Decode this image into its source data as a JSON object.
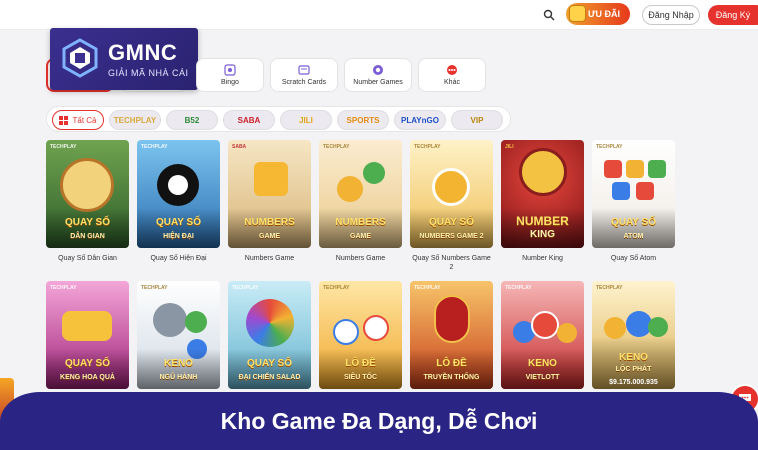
{
  "header": {
    "promo_label": "ƯU ĐÃI",
    "login_label": "Đăng Nhập",
    "register_label": "Đăng Ký"
  },
  "logo": {
    "title": "GMNC",
    "subtitle": "GIẢI MÃ NHÀ CÁI"
  },
  "categories": [
    {
      "label": "Bingo",
      "icon": "bingo-icon"
    },
    {
      "label": "Scratch Cards",
      "icon": "scratch-card-icon"
    },
    {
      "label": "Number Games",
      "icon": "number-ball-icon"
    },
    {
      "label": "Khác",
      "icon": "more-icon"
    }
  ],
  "providers": {
    "all_label": "Tất Cả",
    "items": [
      "TECHPLAY",
      "B52",
      "SABA",
      "JILI",
      "SPORTS",
      "PLAYnGO",
      "VIP"
    ]
  },
  "games_row1": [
    {
      "name": "Quay Số Dân Gian",
      "line1": "QUAY SỐ",
      "line2": "DÂN GIAN",
      "provider": "TECHPLAY",
      "bg": "#3f7a3a"
    },
    {
      "name": "Quay Số Hiện Đại",
      "line1": "QUAY SỐ",
      "line2": "HIỆN ĐẠI",
      "provider": "TECHPLAY",
      "bg": "#2d7fc2"
    },
    {
      "name": "Numbers Game",
      "line1": "NUMBERS",
      "line2": "GAME",
      "provider": "SABA",
      "bg": "#e7c98a"
    },
    {
      "name": "Numbers Game",
      "line1": "NUMBERS",
      "line2": "GAME",
      "provider": "TECHPLAY",
      "bg": "#f2d9a8"
    },
    {
      "name": "Quay Số Numbers Game 2",
      "line1": "QUAY SỐ",
      "line2": "NUMBERS GAME 2",
      "provider": "TECHPLAY",
      "bg": "#f3d58a"
    },
    {
      "name": "Number King",
      "line1": "NUMBER",
      "line2": "KING",
      "provider": "JILI",
      "bg": "#b4262a"
    },
    {
      "name": "Quay Số Atom",
      "line1": "QUAY SỐ",
      "line2": "ATOM",
      "provider": "TECHPLAY",
      "bg": "#f4f1ee"
    }
  ],
  "games_row2": [
    {
      "line1": "QUAY SỐ",
      "line2": "KENG HOA QUẢ",
      "provider": "TECHPLAY",
      "bg": "#c13d91"
    },
    {
      "line1": "KENO",
      "line2": "NGŨ HÀNH",
      "provider": "TECHPLAY",
      "bg": "#e9eef4"
    },
    {
      "line1": "QUAY SỐ",
      "line2": "ĐẠI CHIẾN SALAD",
      "provider": "TECHPLAY",
      "bg": "#9bcde0"
    },
    {
      "line1": "LÔ ĐỀ",
      "line2": "SIÊU TỐC",
      "provider": "TECHPLAY",
      "bg": "#f2b634"
    },
    {
      "line1": "LÔ ĐỀ",
      "line2": "TRUYỀN THỐNG",
      "provider": "TECHPLAY",
      "bg": "#e06a2d"
    },
    {
      "line1": "KENO",
      "line2": "VIETLOTT",
      "provider": "TECHPLAY",
      "bg": "#d94a4a"
    },
    {
      "line1": "KENO",
      "line2": "LỘC PHÁT",
      "provider": "TECHPLAY",
      "bg": "#e2c77a",
      "jackpot": "$9.175.000.935"
    }
  ],
  "banner": {
    "text": "Kho Game Đa Dạng, Dễ Chơi"
  }
}
